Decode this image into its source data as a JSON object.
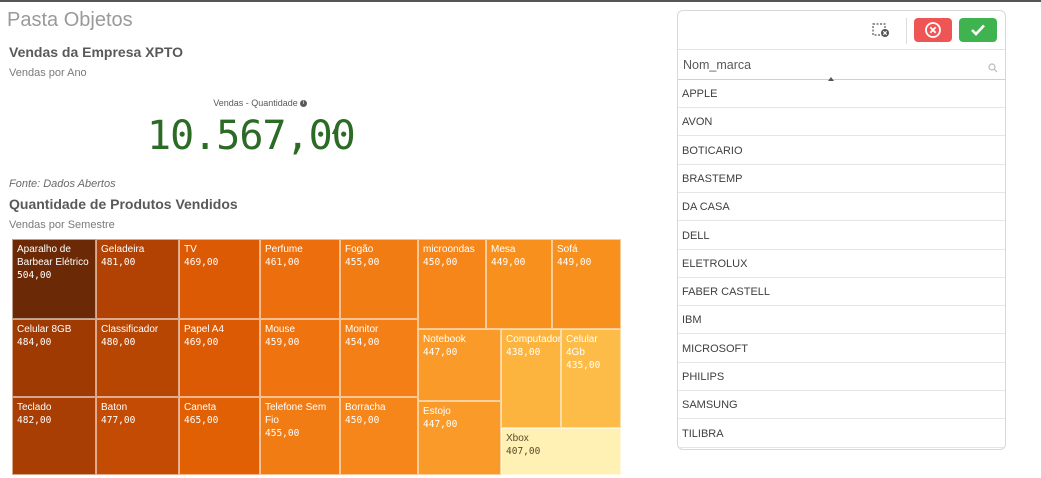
{
  "sheet": {
    "title": "Pasta Objetos"
  },
  "kpi_panel": {
    "title": "Vendas da Empresa XPTO",
    "subtitle": "Vendas por Ano",
    "measure_label": "Vendas - Quantidade",
    "value": "10.567,00",
    "trend_icon": "triangle-up-icon",
    "footnote": "Fonte: Dados Abertos"
  },
  "treemap_panel": {
    "title": "Quantidade de Produtos Vendidos",
    "subtitle": "Vendas por Semestre"
  },
  "chart_data": {
    "type": "treemap",
    "title": "Quantidade de Produtos Vendidos",
    "subtitle": "Vendas por Semestre",
    "items": [
      {
        "label": "Aparalho de Barbear Elétrico",
        "value": 504,
        "value_text": "504,00",
        "color": "#6b2a05"
      },
      {
        "label": "Celular 8GB",
        "value": 484,
        "value_text": "484,00",
        "color": "#a03a03"
      },
      {
        "label": "Teclado",
        "value": 482,
        "value_text": "482,00",
        "color": "#a83e03"
      },
      {
        "label": "Geladeira",
        "value": 481,
        "value_text": "481,00",
        "color": "#b14203"
      },
      {
        "label": "Classificador",
        "value": 480,
        "value_text": "480,00",
        "color": "#b84603"
      },
      {
        "label": "Baton",
        "value": 477,
        "value_text": "477,00",
        "color": "#c44b03"
      },
      {
        "label": "TV",
        "value": 469,
        "value_text": "469,00",
        "color": "#dd5a04"
      },
      {
        "label": "Papel A4",
        "value": 469,
        "value_text": "469,00",
        "color": "#dd5a04"
      },
      {
        "label": "Caneta",
        "value": 465,
        "value_text": "465,00",
        "color": "#e26004"
      },
      {
        "label": "Perfume",
        "value": 461,
        "value_text": "461,00",
        "color": "#ec6e0c"
      },
      {
        "label": "Mouse",
        "value": 459,
        "value_text": "459,00",
        "color": "#ef7410"
      },
      {
        "label": "Telefone Sem Fio",
        "value": 455,
        "value_text": "455,00",
        "color": "#f27c14"
      },
      {
        "label": "Fogão",
        "value": 455,
        "value_text": "455,00",
        "color": "#f27c14"
      },
      {
        "label": "Monitor",
        "value": 454,
        "value_text": "454,00",
        "color": "#f37f16"
      },
      {
        "label": "Borracha",
        "value": 450,
        "value_text": "450,00",
        "color": "#f6861a"
      },
      {
        "label": "microondas",
        "value": 450,
        "value_text": "450,00",
        "color": "#f6861a"
      },
      {
        "label": "Mesa",
        "value": 449,
        "value_text": "449,00",
        "color": "#f8901e"
      },
      {
        "label": "Sofá",
        "value": 449,
        "value_text": "449,00",
        "color": "#f8901e"
      },
      {
        "label": "Notebook",
        "value": 447,
        "value_text": "447,00",
        "color": "#fa9a28"
      },
      {
        "label": "Estojo",
        "value": 447,
        "value_text": "447,00",
        "color": "#fa9a28"
      },
      {
        "label": "Computador",
        "value": 438,
        "value_text": "438,00",
        "color": "#fdb43f"
      },
      {
        "label": "Celular 4Gb",
        "value": 435,
        "value_text": "435,00",
        "color": "#fdbb47"
      },
      {
        "label": "Xbox",
        "value": 407,
        "value_text": "407,00",
        "color": "#fff0b3"
      }
    ]
  },
  "listbox": {
    "field_name": "Nom_marca",
    "toolbar": {
      "clear_icon": "clear-selections-icon",
      "cancel_icon": "cancel-icon",
      "confirm_icon": "check-icon"
    },
    "items": [
      "APPLE",
      "AVON",
      "BOTICARIO",
      "BRASTEMP",
      "DA CASA",
      "DELL",
      "ELETROLUX",
      "FABER CASTELL",
      "IBM",
      "MICROSOFT",
      "PHILIPS",
      "SAMSUNG",
      "TILIBRA"
    ]
  }
}
